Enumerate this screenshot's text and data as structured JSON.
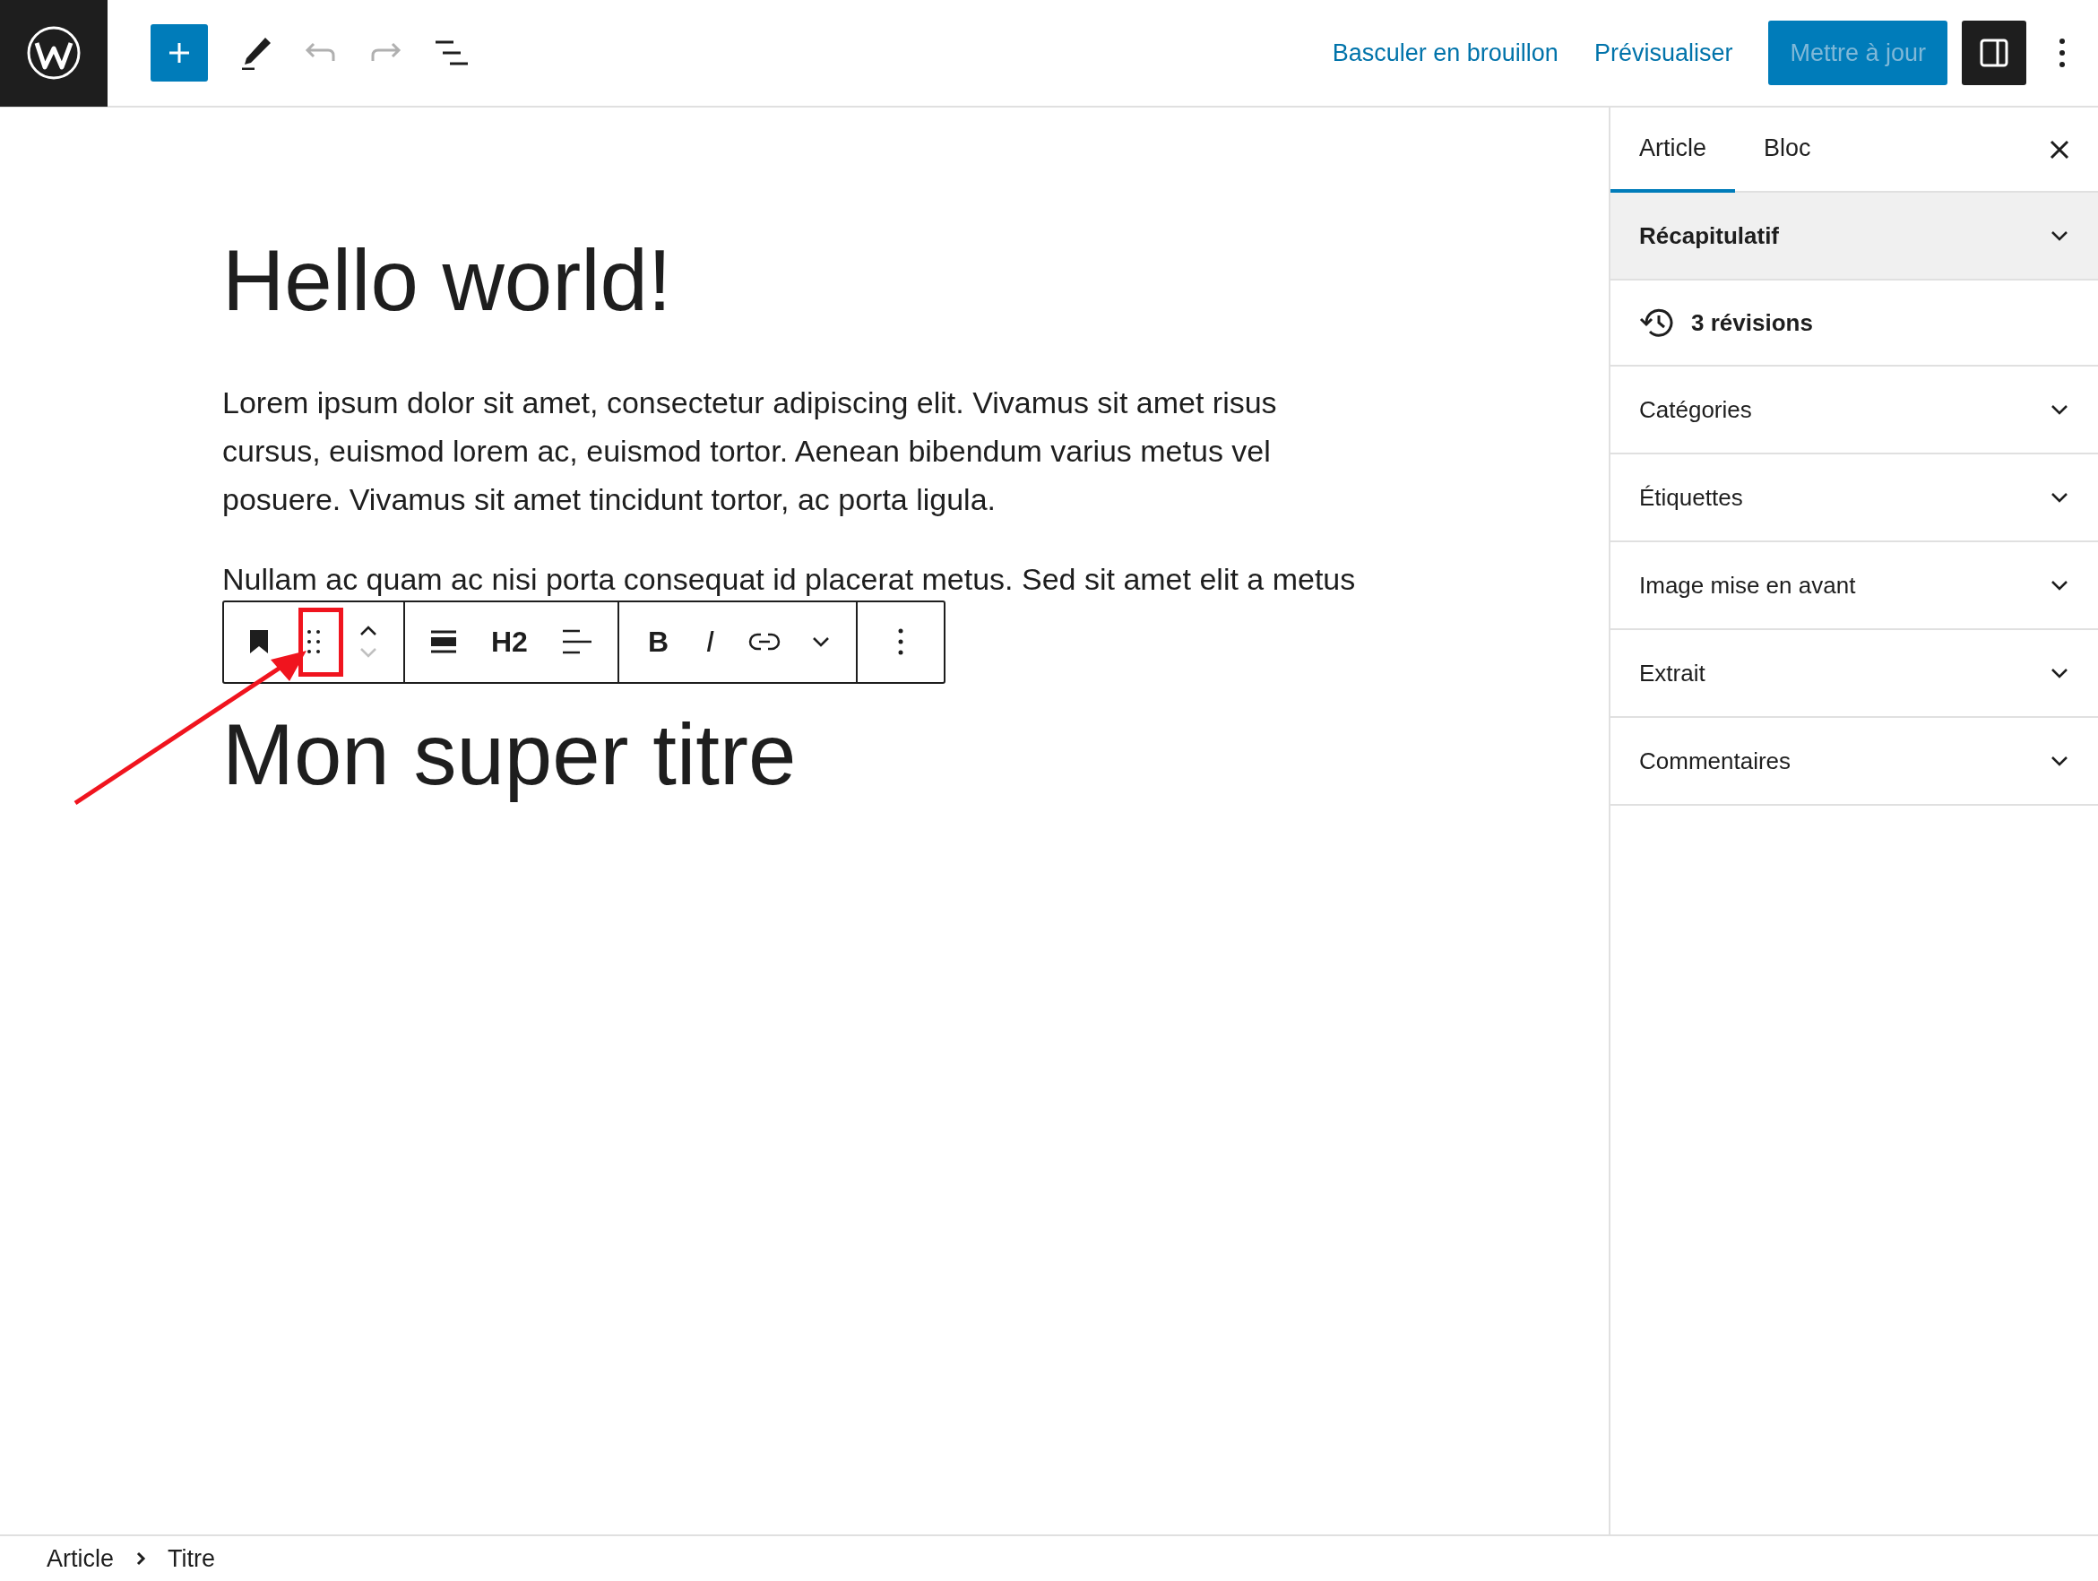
{
  "header": {
    "undo_disabled": true,
    "redo_disabled": true,
    "draft_link": "Basculer en brouillon",
    "preview_link": "Prévisualiser",
    "update_button": {
      "label": "Mettre à jour",
      "disabled": true
    }
  },
  "editor": {
    "title": "Hello world!",
    "paragraphs": [
      "Lorem ipsum dolor sit amet, consectetur adipiscing elit. Vivamus sit amet risus cursus, euismod lorem ac, euismod tortor. Aenean bibendum varius metus vel posuere. Vivamus sit amet tincidunt tortor, ac porta ligula.",
      "Nullam ac quam ac nisi porta consequat id placerat metus. Sed sit amet elit a metus"
    ],
    "toolbar": {
      "move_down_disabled": true,
      "heading_level": "H2",
      "bold": "B",
      "italic": "I"
    },
    "heading": "Mon super titre"
  },
  "sidebar": {
    "tabs": [
      {
        "label": "Article",
        "selected": true
      },
      {
        "label": "Bloc",
        "selected": false
      }
    ],
    "panels": [
      {
        "kind": "panel",
        "label": "Récapitulatif",
        "hovered": true
      },
      {
        "kind": "revisions",
        "label": "3 révisions",
        "hovered": false
      },
      {
        "kind": "panel",
        "label": "Catégories",
        "hovered": false
      },
      {
        "kind": "panel",
        "label": "Étiquettes",
        "hovered": false
      },
      {
        "kind": "panel",
        "label": "Image mise en avant",
        "hovered": false
      },
      {
        "kind": "panel",
        "label": "Extrait",
        "hovered": false
      },
      {
        "kind": "panel",
        "label": "Commentaires",
        "hovered": false
      }
    ]
  },
  "breadcrumb": [
    "Article",
    "Titre"
  ]
}
